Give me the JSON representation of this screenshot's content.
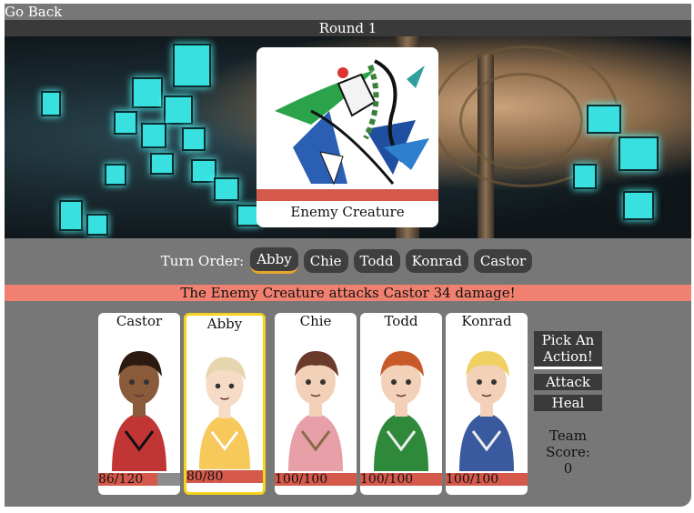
{
  "nav": {
    "back_label": "Go Back"
  },
  "round": {
    "label": "Round 1"
  },
  "enemy": {
    "name": "Enemy Creature",
    "hp_fraction": 1.0
  },
  "turn_order": {
    "label": "Turn Order:",
    "members": [
      "Abby",
      "Chie",
      "Todd",
      "Konrad",
      "Castor"
    ],
    "active": "Abby"
  },
  "message": "The Enemy Creature attacks Castor 34 damage!",
  "party": [
    {
      "name": "Castor",
      "hp_text": "86/120",
      "hp_fraction": 0.717,
      "active": false
    },
    {
      "name": "Abby",
      "hp_text": "80/80",
      "hp_fraction": 1.0,
      "active": true
    },
    {
      "name": "Chie",
      "hp_text": "100/100",
      "hp_fraction": 1.0,
      "active": false
    },
    {
      "name": "Todd",
      "hp_text": "100/100",
      "hp_fraction": 1.0,
      "active": false
    },
    {
      "name": "Konrad",
      "hp_text": "100/100",
      "hp_fraction": 1.0,
      "active": false
    }
  ],
  "actions": {
    "prompt": "Pick An Action!",
    "attack_label": "Attack",
    "heal_label": "Heal"
  },
  "score": {
    "label": "Team Score:",
    "value": "0"
  },
  "colors": {
    "frame": "#777777",
    "bar": "#3a3a3a",
    "hp": "#d4594b",
    "message": "#f08070",
    "active_border": "#f2d21a"
  }
}
